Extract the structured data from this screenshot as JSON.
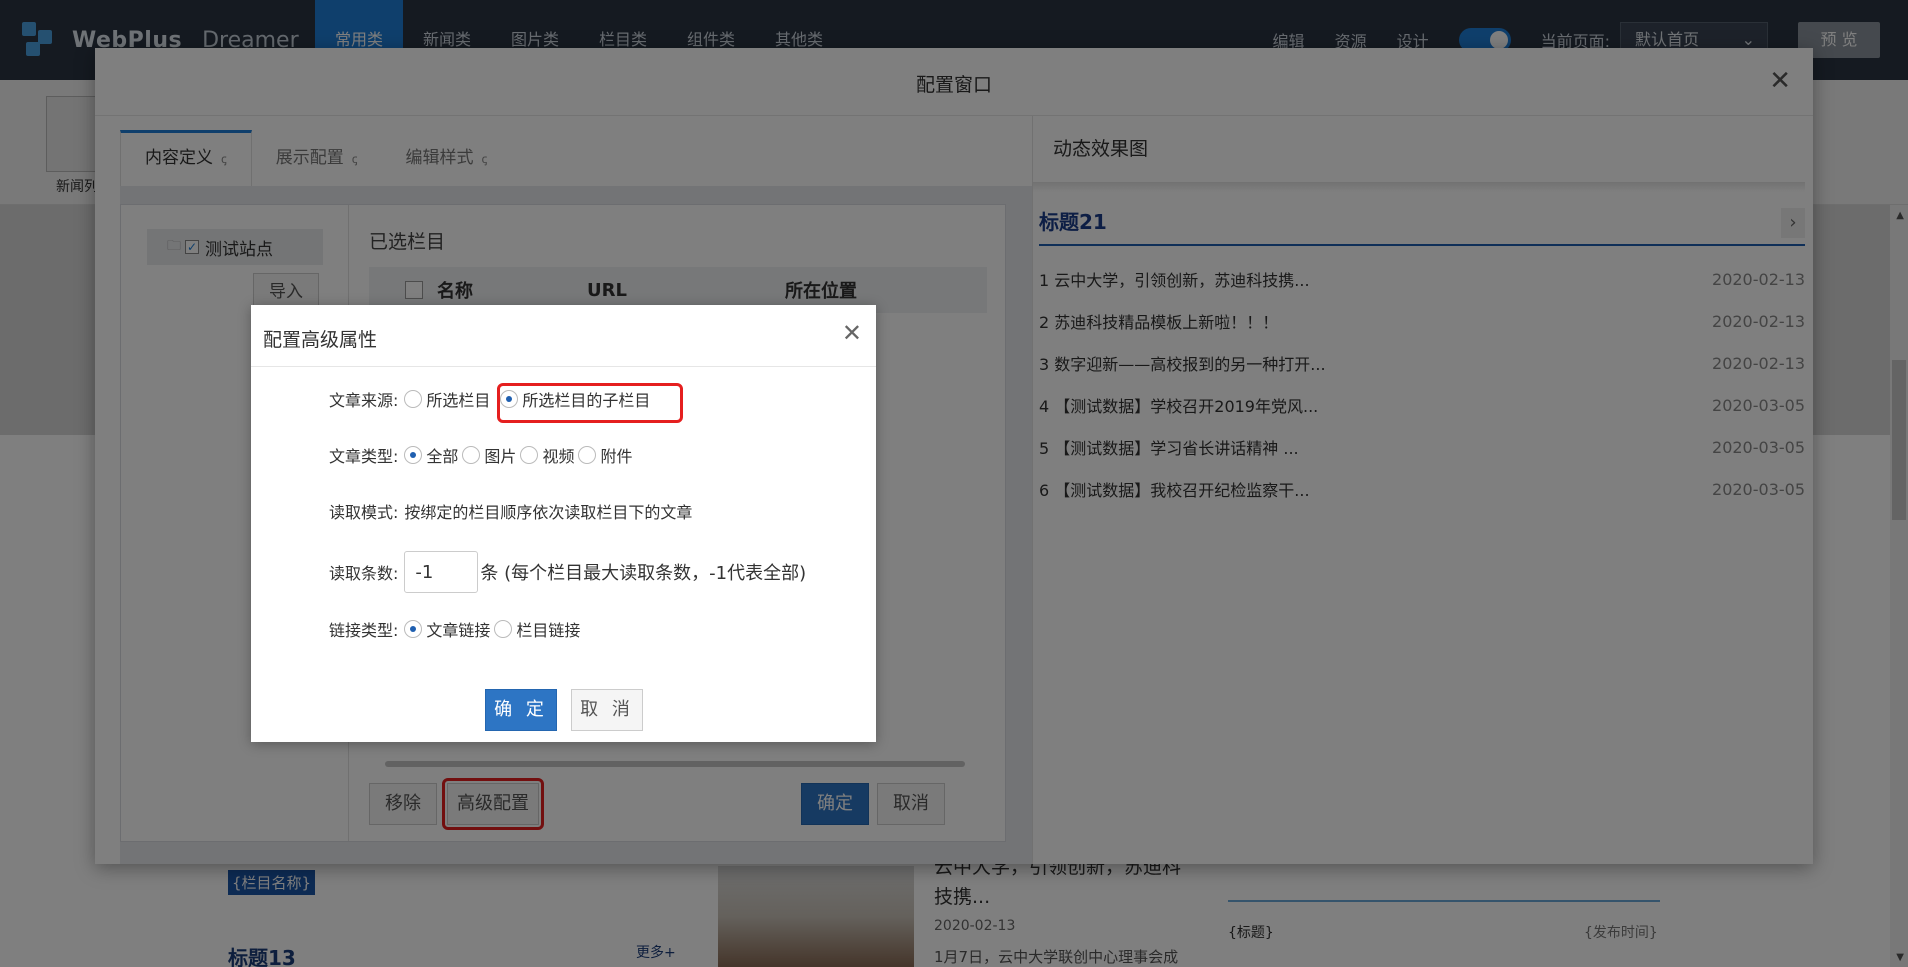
{
  "app": {
    "logo_text": "WebPlus",
    "logo_sub": "Dreamer",
    "nav": [
      "常用类",
      "新闻类",
      "图片类",
      "栏目类",
      "组件类",
      "其他类"
    ],
    "top_links": [
      "编辑",
      "资源",
      "设计"
    ],
    "current_page_label": "当前页面:",
    "current_page_value": "默认首页",
    "preview_label": "预 览",
    "widget_label": "新闻列",
    "bg_tag": "{栏目名称}",
    "bg_title13": "标题13",
    "bg_more": "更多+",
    "bg_news_title": "云中大学，引领创新，苏迪科技携...",
    "bg_news_date": "2020-02-13",
    "bg_news_desc": "1月7日，云中大学联创中心理事会成",
    "bg_list_title": "{标题}",
    "bg_list_time": "{发布时间}"
  },
  "config_window": {
    "title": "配置窗口",
    "tabs": [
      {
        "label": "内容定义",
        "refresh": "ꞔ"
      },
      {
        "label": "展示配置",
        "refresh": "ꞔ"
      },
      {
        "label": "编辑样式",
        "refresh": "ꞔ"
      }
    ],
    "tree_node_label": "测试站点",
    "import_label": "导入",
    "selected_title": "已选栏目",
    "table_headers": {
      "name": "名称",
      "url": "URL",
      "location": "所在位置"
    },
    "remove_label": "移除",
    "advanced_label": "高级配置",
    "ok_label": "确定",
    "cancel_label": "取消"
  },
  "preview": {
    "title": "动态效果图",
    "news_title": "标题21",
    "items": [
      {
        "text": "1 云中大学，引领创新，苏迪科技携...",
        "date": "2020-02-13"
      },
      {
        "text": "2 苏迪科技精品模板上新啦！！！",
        "date": "2020-02-13"
      },
      {
        "text": "3 数字迎新——高校报到的另一种打开...",
        "date": "2020-02-13"
      },
      {
        "text": "4 【测试数据】学校召开2019年党风...",
        "date": "2020-03-05"
      },
      {
        "text": "5 【测试数据】学习省长讲话精神 ...",
        "date": "2020-03-05"
      },
      {
        "text": "6 【测试数据】我校召开纪检监察干...",
        "date": "2020-03-05"
      }
    ]
  },
  "advanced_dialog": {
    "title": "配置高级属性",
    "source_label": "文章来源:",
    "source_opt1": "所选栏目",
    "source_opt2": "所选栏目的子栏目",
    "type_label": "文章类型:",
    "type_opts": [
      "全部",
      "图片",
      "视频",
      "附件"
    ],
    "mode_label": "读取模式:",
    "mode_value": "按绑定的栏目顺序依次读取栏目下的文章",
    "count_label": "读取条数:",
    "count_value": "-1",
    "count_suffix": "条 (每个栏目最大读取条数，-1代表全部)",
    "link_label": "链接类型:",
    "link_opt1": "文章链接",
    "link_opt2": "栏目链接",
    "ok_label": "确 定",
    "cancel_label": "取 消"
  },
  "colors": {
    "highlight": "#e51f1f",
    "primary": "#2d75c4",
    "topbar": "#2a3442"
  }
}
